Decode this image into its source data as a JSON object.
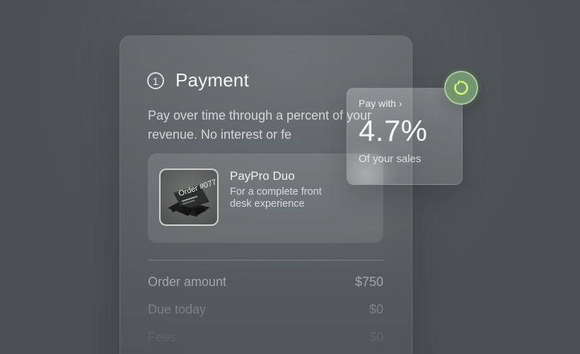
{
  "payment": {
    "step_number": "1",
    "title": "Payment",
    "description": "Pay over time through a percent of your revenue. No interest or fe",
    "product": {
      "name": "PayPro Duo",
      "subtitle": "For a complete front desk experience",
      "screen_text": "Order #077"
    },
    "summary": [
      {
        "label": "Order amount",
        "value": "$750"
      },
      {
        "label": "Due today",
        "value": "$0"
      },
      {
        "label": "Fees",
        "value": "$0"
      }
    ]
  },
  "offer": {
    "link_label": "Pay with ›",
    "rate": "4.7%",
    "caption": "Of your sales"
  },
  "icons": {
    "status": "progress-ring-icon",
    "product": "card-reader-device-icon"
  },
  "colors": {
    "background": "#4f5456",
    "badge": "#73966f",
    "badge_ring": "#d9f27d"
  }
}
